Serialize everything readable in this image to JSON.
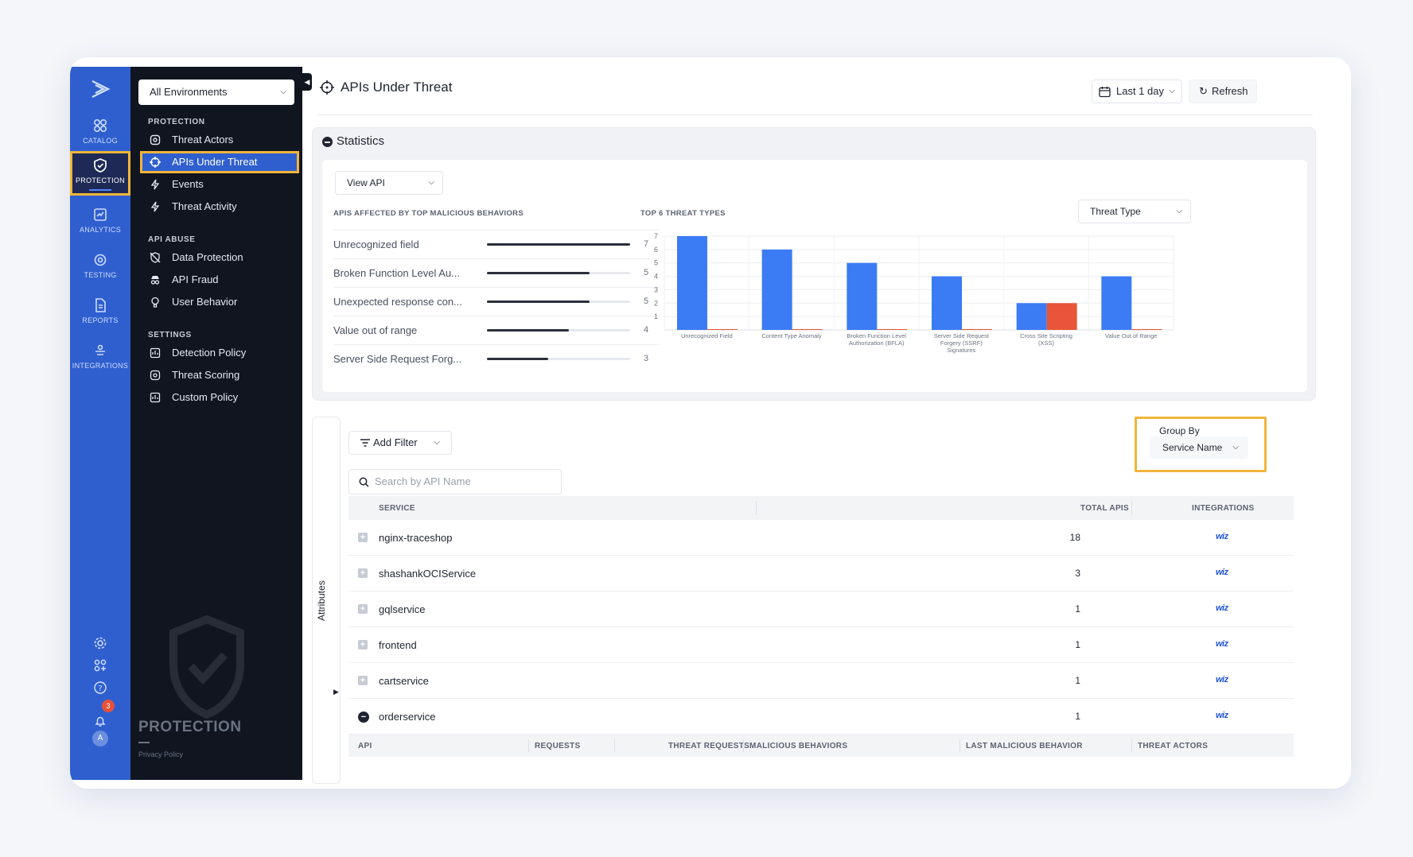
{
  "rail": {
    "items": [
      {
        "label": "CATALOG",
        "icon": "catalog-icon"
      },
      {
        "label": "PROTECTION",
        "icon": "shield-icon",
        "active": true
      },
      {
        "label": "ANALYTICS",
        "icon": "analytics-icon"
      },
      {
        "label": "TESTING",
        "icon": "testing-icon"
      },
      {
        "label": "REPORTS",
        "icon": "reports-icon"
      },
      {
        "label": "INTEGRATIONS",
        "icon": "integrations-icon"
      }
    ],
    "notification_count": "3",
    "avatar_initial": "A"
  },
  "nav": {
    "environment": "All Environments",
    "sections": {
      "protection": "PROTECTION",
      "api_abuse": "API ABUSE",
      "settings": "SETTINGS"
    },
    "items": {
      "threat_actors": "Threat Actors",
      "apis_under_threat": "APIs Under Threat",
      "events": "Events",
      "threat_activity": "Threat Activity",
      "data_protection": "Data Protection",
      "api_fraud": "API Fraud",
      "user_behavior": "User Behavior",
      "detection_policy": "Detection Policy",
      "threat_scoring": "Threat Scoring",
      "custom_policy": "Custom Policy"
    },
    "footer_title": "PROTECTION",
    "footer_link": "Privacy Policy"
  },
  "header": {
    "title": "APIs Under Threat",
    "time_range": "Last 1 day",
    "refresh": "Refresh"
  },
  "stats": {
    "title": "Statistics",
    "view_select": "View API",
    "behaviors_label": "APIS AFFECTED BY TOP MALICIOUS BEHAVIORS",
    "behaviors": [
      {
        "name": "Unrecognized field",
        "value": 7
      },
      {
        "name": "Broken Function Level Au...",
        "value": 5
      },
      {
        "name": "Unexpected response con...",
        "value": 5
      },
      {
        "name": "Value out of range",
        "value": 4
      },
      {
        "name": "Server Side Request Forg...",
        "value": 3
      }
    ],
    "behaviors_max": 7,
    "threat_types_label": "TOP 6 THREAT TYPES",
    "threat_type_select": "Threat Type"
  },
  "chart_data": {
    "type": "bar",
    "categories": [
      "Unrecognized Field",
      "Content Type Anomaly",
      "Broken Function Level Authorization (BFLA)",
      "Server Side Request Forgery (SSRF) Signatures",
      "Cross Site Scripting (XSS)",
      "Value Out of Range"
    ],
    "series": [
      {
        "values": [
          7,
          6,
          5,
          4,
          2,
          4
        ],
        "color": "#3b7cf5"
      },
      {
        "values": [
          0,
          0,
          0,
          0,
          2,
          0
        ],
        "color": "#e8553b"
      }
    ],
    "yticks": [
      1,
      2,
      3,
      4,
      5,
      6,
      7
    ],
    "ylim": [
      0,
      7
    ],
    "grid": true
  },
  "table": {
    "add_filter": "Add Filter",
    "group_by_label": "Group By",
    "group_by_value": "Service Name",
    "search_placeholder": "Search by API Name",
    "attributes_label": "Attributes",
    "columns": {
      "service": "SERVICE",
      "total_apis": "TOTAL APIS",
      "integrations": "INTEGRATIONS"
    },
    "rows": [
      {
        "service": "nginx-traceshop",
        "total": "18",
        "integration": "wiz"
      },
      {
        "service": "shashankOCIService",
        "total": "3",
        "integration": "wiz"
      },
      {
        "service": "gqlservice",
        "total": "1",
        "integration": "wiz"
      },
      {
        "service": "frontend",
        "total": "1",
        "integration": "wiz"
      },
      {
        "service": "cartservice",
        "total": "1",
        "integration": "wiz"
      },
      {
        "service": "orderservice",
        "total": "1",
        "integration": "wiz"
      }
    ],
    "api_columns": {
      "api": "API",
      "requests": "REQUESTS",
      "threat_requests": "THREAT REQUESTS",
      "malicious_behaviors": "MALICIOUS BEHAVIORS",
      "last_malicious_behavior": "LAST MALICIOUS BEHAVIOR",
      "threat_actors": "THREAT ACTORS"
    }
  }
}
